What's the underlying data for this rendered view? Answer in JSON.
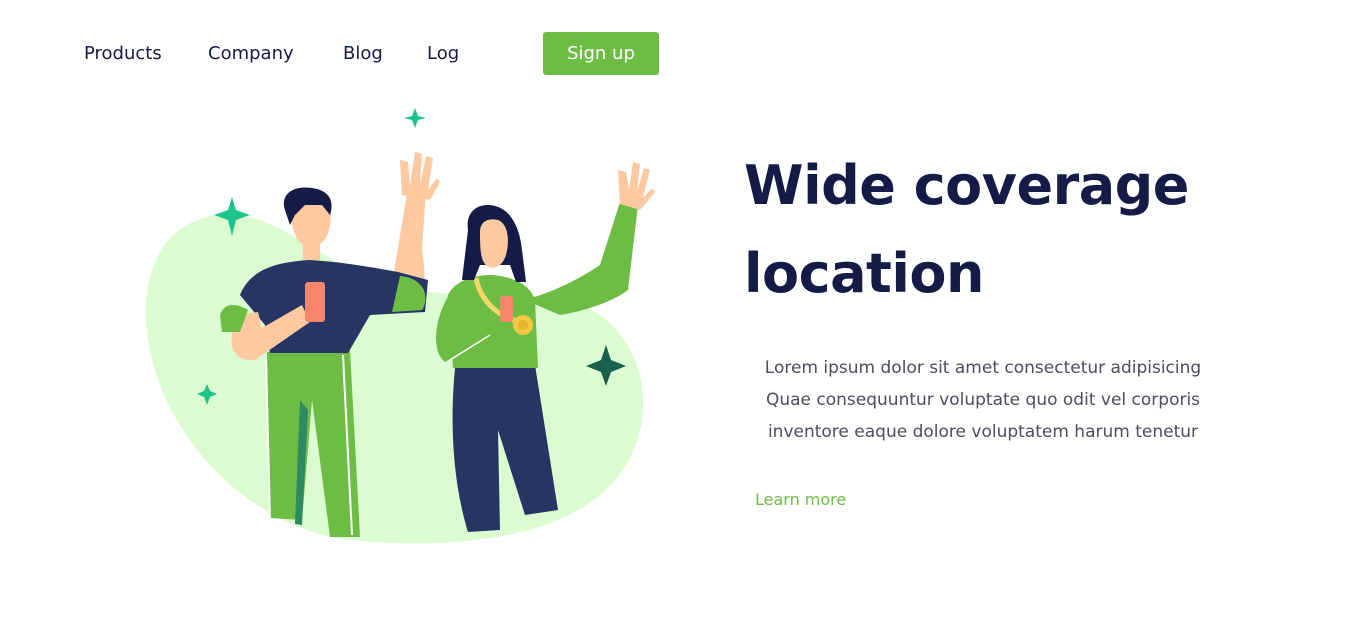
{
  "nav": {
    "links": [
      "Products",
      "Company",
      "Blog",
      "Log"
    ],
    "signup_label": "Sign up"
  },
  "hero": {
    "title_line1": "Wide coverage",
    "title_line2": "location",
    "description_line1": "Lorem ipsum dolor sit amet consectetur adipisicing",
    "description_line2": "Quae consequuntur voluptate quo odit vel corporis",
    "description_line3": "inventore eaque dolore voluptatem harum tenetur",
    "learn_more_label": "Learn more"
  },
  "colors": {
    "accent": "#6dbd45",
    "heading": "#141b46",
    "blob": "#dbfbd0",
    "sparkle": "#1fc48b"
  }
}
